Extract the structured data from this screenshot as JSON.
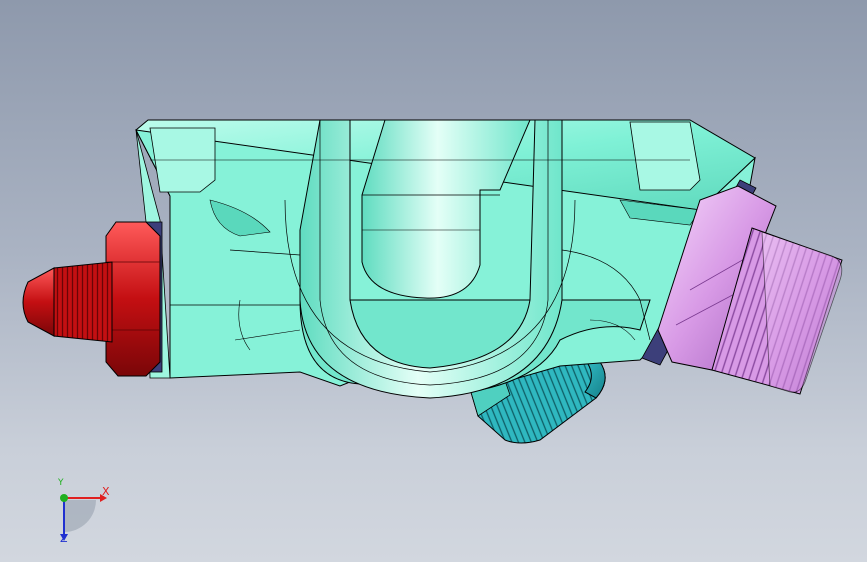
{
  "viewport": {
    "background_top": "#8e99ac",
    "background_bottom": "#d2d7df"
  },
  "model": {
    "body_color": "#7ff1d6",
    "left_fitting_color": "#c40f12",
    "right_fitting_color": "#d89ae6",
    "bottom_fitting_color": "#2fb8c0",
    "edge_color": "#000000"
  },
  "triad": {
    "x_label": "X",
    "y_label": "Y",
    "z_label": "Z",
    "x_color": "#e02020",
    "y_color": "#20b020",
    "z_color": "#2030d0"
  }
}
